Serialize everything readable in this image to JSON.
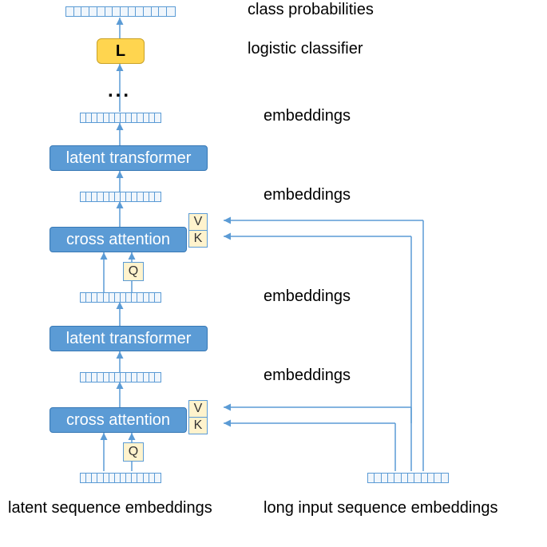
{
  "labels": {
    "class_probabilities": "class probabilities",
    "logistic_classifier": "logistic classifier",
    "embeddings_1": "embeddings",
    "embeddings_2": "embeddings",
    "embeddings_3": "embeddings",
    "embeddings_4": "embeddings",
    "latent_seq": "latent sequence embeddings",
    "long_input_seq": "long input sequence embeddings"
  },
  "blocks": {
    "latent_transformer_1": "latent transformer",
    "latent_transformer_2": "latent transformer",
    "cross_attention_1": "cross attention",
    "cross_attention_2": "cross attention",
    "classifier_L": "L",
    "Q": "Q",
    "V": "V",
    "K": "K",
    "dots": "..."
  },
  "cells": {
    "n_small": 14,
    "n_long": 12
  }
}
